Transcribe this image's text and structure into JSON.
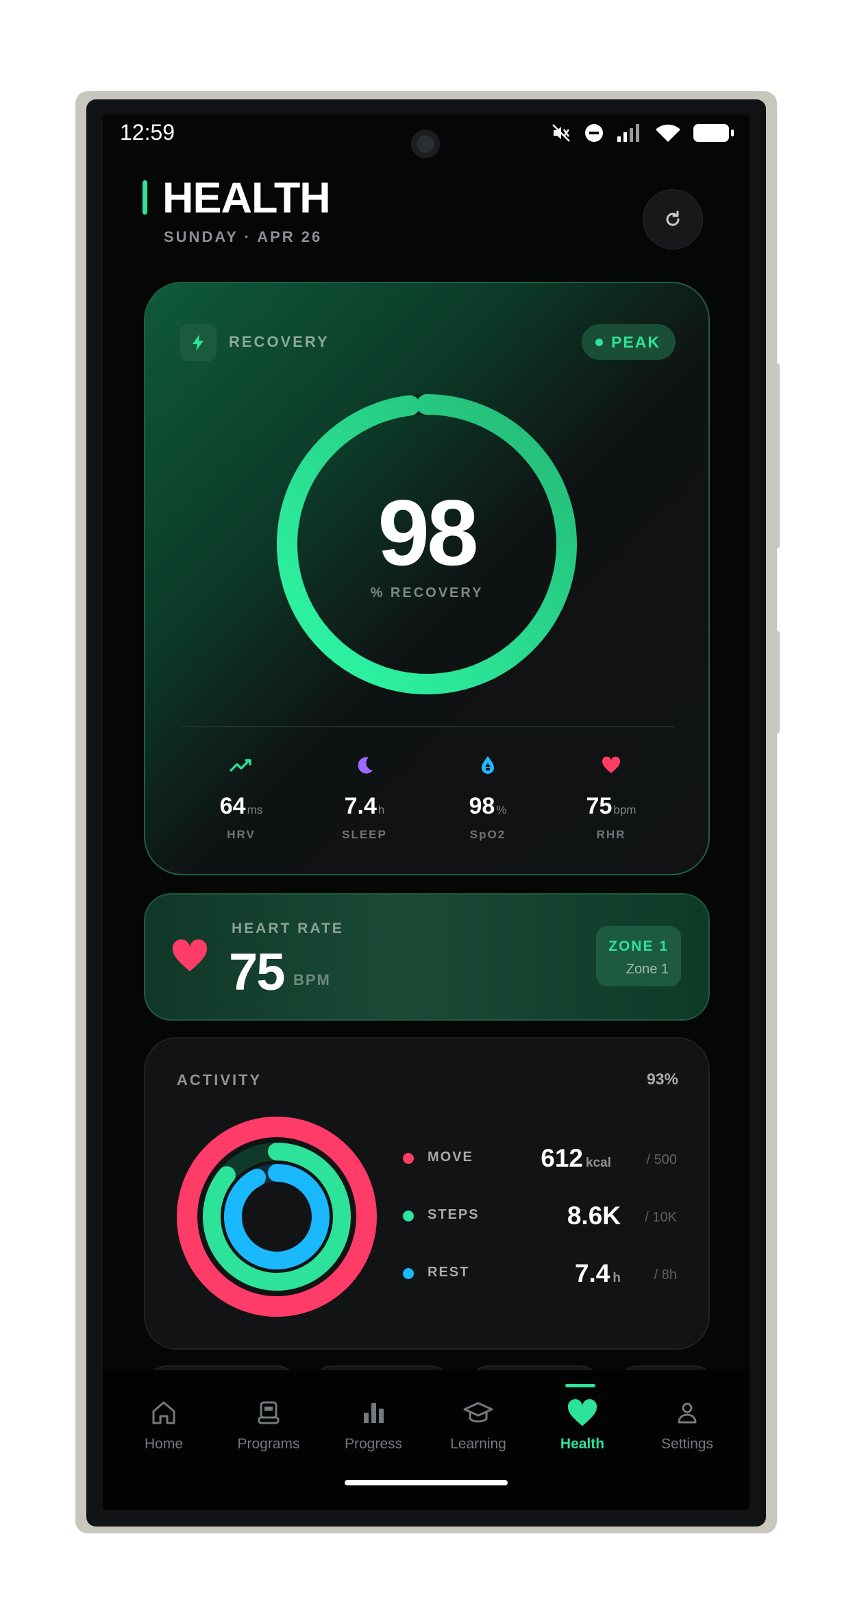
{
  "status_bar": {
    "time": "12:59"
  },
  "header": {
    "title": "HEALTH",
    "date": "SUNDAY · APR 26"
  },
  "recovery": {
    "label": "RECOVERY",
    "badge": "PEAK",
    "value": "98",
    "value_fraction": 0.98,
    "unit": "%  RECOVERY",
    "metrics": [
      {
        "icon": "trend-line-icon",
        "value": "64",
        "unit": "ms",
        "label": "HRV",
        "color": "#2de39a"
      },
      {
        "icon": "moon-icon",
        "value": "7.4",
        "unit": "h",
        "label": "SLEEP",
        "color": "#9b6bff"
      },
      {
        "icon": "drop-icon",
        "value": "98",
        "unit": "%",
        "label": "SpO2",
        "color": "#23b7ff"
      },
      {
        "icon": "heart-icon",
        "value": "75",
        "unit": "bpm",
        "label": "RHR",
        "color": "#ff3b68"
      }
    ]
  },
  "heart_rate": {
    "label": "HEART RATE",
    "value": "75",
    "unit": "BPM",
    "zone_title": "ZONE 1",
    "zone_name": "Zone 1"
  },
  "activity": {
    "title": "ACTIVITY",
    "percent": "93%",
    "rows": [
      {
        "name": "MOVE",
        "value": "612",
        "unit": "kcal",
        "goal": "/ 500",
        "color": "#ff3b68",
        "fraction": 1.0
      },
      {
        "name": "STEPS",
        "value": "8.6K",
        "unit": "",
        "goal": "/ 10K",
        "color": "#2de39a",
        "fraction": 0.86
      },
      {
        "name": "REST",
        "value": "7.4",
        "unit": "h",
        "goal": "/ 8h",
        "color": "#1ab8ff",
        "fraction": 0.925
      }
    ]
  },
  "nav": {
    "items": [
      {
        "label": "Home",
        "icon": "home-icon"
      },
      {
        "label": "Programs",
        "icon": "programs-icon"
      },
      {
        "label": "Progress",
        "icon": "bar-chart-icon"
      },
      {
        "label": "Learning",
        "icon": "graduation-cap-icon"
      },
      {
        "label": "Health",
        "icon": "heart-icon",
        "active": true
      },
      {
        "label": "Settings",
        "icon": "person-icon"
      }
    ]
  },
  "colors": {
    "accent": "#2de39a",
    "background": "#050606",
    "heart": "#ff3b68"
  }
}
